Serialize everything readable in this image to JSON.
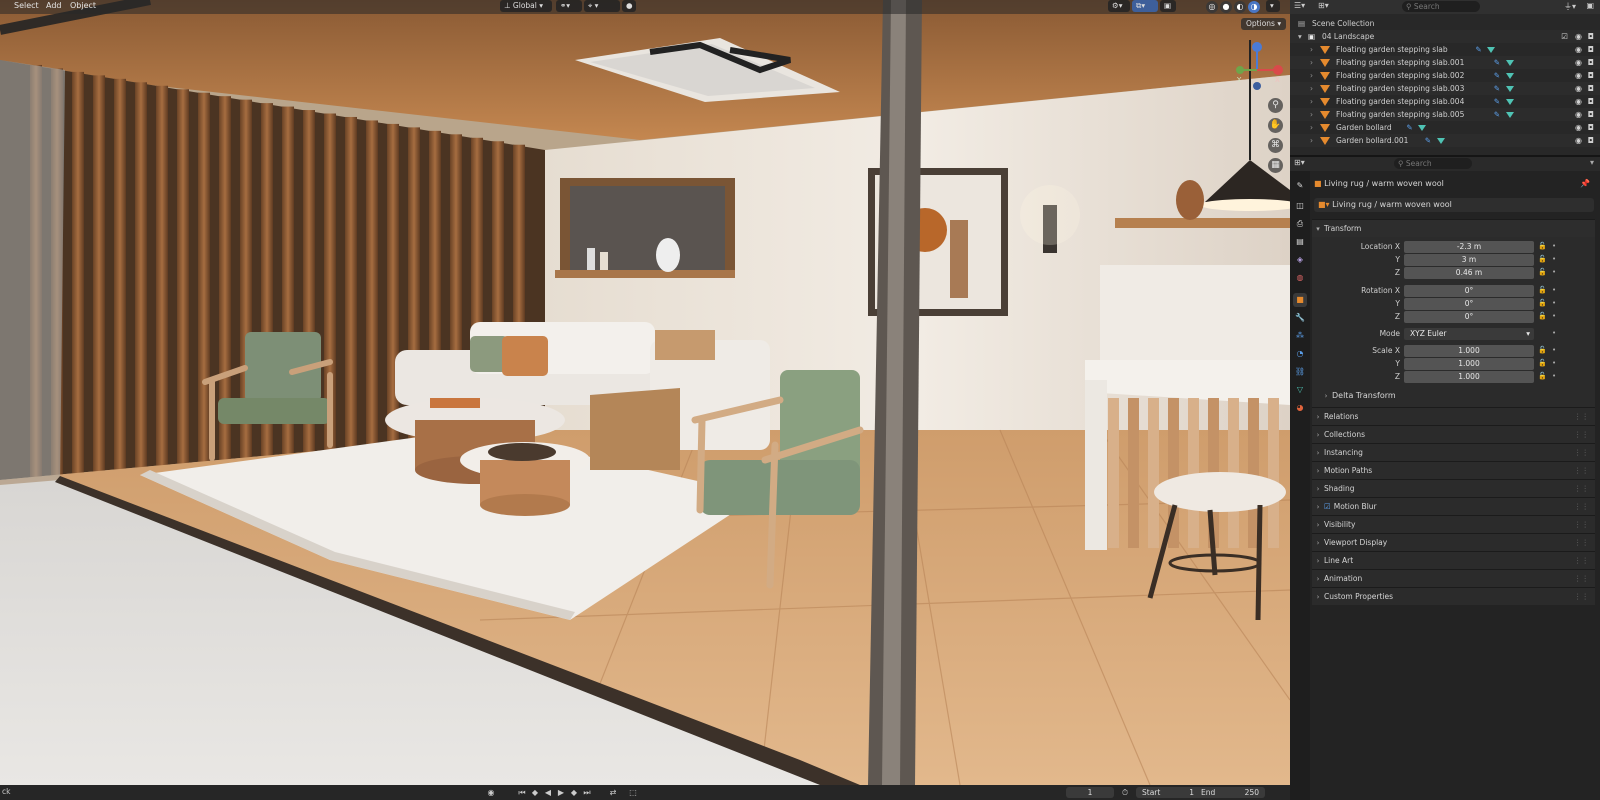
{
  "header": {
    "menu": [
      "Select",
      "Add",
      "Object"
    ],
    "orientation": "Global",
    "options_label": "Options"
  },
  "gizmo": {
    "axis_y": "Y",
    "axis_x": "X"
  },
  "outliner": {
    "search_placeholder": "Search",
    "scene_collection": "Scene Collection",
    "collection": "04 Landscape",
    "items": [
      "Floating garden stepping slab",
      "Floating garden stepping slab.001",
      "Floating garden stepping slab.002",
      "Floating garden stepping slab.003",
      "Floating garden stepping slab.004",
      "Floating garden stepping slab.005",
      "Garden bollard",
      "Garden bollard.001"
    ]
  },
  "properties": {
    "search_placeholder": "Search",
    "object_name": "Living rug / warm woven wool",
    "data_name": "Living rug / warm woven wool",
    "transform_label": "Transform",
    "location": {
      "label_x": "Location X",
      "label_y": "Y",
      "label_z": "Z",
      "x": "-2.3 m",
      "y": "3 m",
      "z": "0.46 m"
    },
    "rotation": {
      "label_x": "Rotation X",
      "label_y": "Y",
      "label_z": "Z",
      "x": "0°",
      "y": "0°",
      "z": "0°"
    },
    "mode": {
      "label": "Mode",
      "value": "XYZ Euler"
    },
    "scale": {
      "label_x": "Scale X",
      "label_y": "Y",
      "label_z": "Z",
      "x": "1.000",
      "y": "1.000",
      "z": "1.000"
    },
    "delta_transform": "Delta Transform",
    "panels": [
      "Relations",
      "Collections",
      "Instancing",
      "Motion Paths",
      "Shading",
      "Motion Blur",
      "Visibility",
      "Viewport Display",
      "Line Art",
      "Animation",
      "Custom Properties"
    ]
  },
  "timeline": {
    "left_text": "ck",
    "current_frame": "1",
    "start_label": "Start",
    "start_value": "1",
    "end_label": "End",
    "end_value": "250"
  },
  "colors": {
    "accent_orange": "#e58a2e",
    "mesh_teal": "#4fc3b4",
    "ui_dark": "#232323"
  }
}
